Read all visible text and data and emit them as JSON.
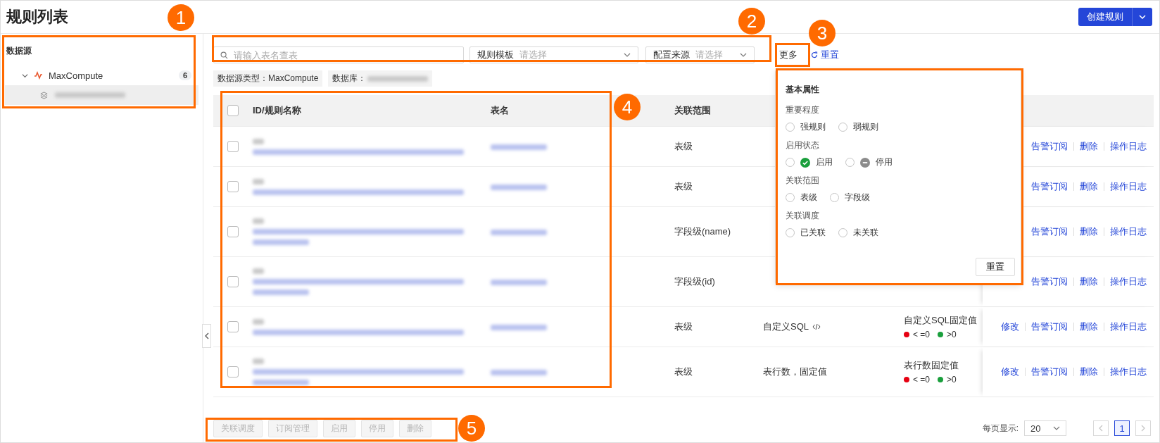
{
  "page_title": "规则列表",
  "create_button": {
    "label": "创建规则"
  },
  "sidebar": {
    "heading": "数据源",
    "tree": [
      {
        "label": "MaxCompute",
        "count": "6",
        "expanded": true,
        "children": [
          {
            "selected": true
          }
        ]
      }
    ]
  },
  "filters": {
    "search": {
      "placeholder": "请输入表名查表"
    },
    "selects": [
      {
        "label": "规则模板",
        "placeholder": "请选择"
      },
      {
        "label": "配置来源",
        "placeholder": "请选择"
      }
    ],
    "more_button": "更多",
    "reset_link": "重置"
  },
  "info_tags": [
    {
      "text": "数据源类型：MaxCompute",
      "redacted": false
    },
    {
      "text": "数据库：",
      "redacted": true
    }
  ],
  "table": {
    "all_checked": false,
    "columns": [
      {
        "label": "ID/规则名称"
      },
      {
        "label": "表名"
      },
      {
        "label": "关联范围"
      }
    ],
    "rows": [
      {
        "checked": false,
        "name_wraps": false,
        "scope": "表级",
        "actions": [
          "告警订阅",
          "删除",
          "操作日志"
        ]
      },
      {
        "checked": false,
        "name_wraps": false,
        "scope": "表级",
        "actions": [
          "告警订阅",
          "删除",
          "操作日志"
        ]
      },
      {
        "checked": false,
        "name_wraps": true,
        "scope": "字段级(name)",
        "actions": [
          "告警订阅",
          "删除",
          "操作日志"
        ]
      },
      {
        "checked": false,
        "name_wraps": true,
        "scope": "字段级(id)",
        "actions": [
          "告警订阅",
          "删除",
          "操作日志"
        ]
      },
      {
        "checked": false,
        "name_wraps": false,
        "scope": "表级",
        "column_5": {
          "text": "自定义SQL",
          "code_icon": true
        },
        "column_6": {
          "title": "自定义SQL固定值",
          "thresholds": [
            {
              "label": "< =0",
              "color": "#e60012"
            },
            {
              "label": ">0",
              "color": "#1a9f3c"
            }
          ]
        },
        "actions": [
          "修改",
          "告警订阅",
          "删除",
          "操作日志"
        ]
      },
      {
        "checked": false,
        "name_wraps": true,
        "scope": "表级",
        "column_5": {
          "text": "表行数，固定值",
          "code_icon": false
        },
        "column_6": {
          "title": "表行数固定值",
          "thresholds": [
            {
              "label": "< =0",
              "color": "#e60012"
            },
            {
              "label": ">0",
              "color": "#1a9f3c"
            }
          ]
        },
        "actions": [
          "修改",
          "告警订阅",
          "删除",
          "操作日志"
        ]
      }
    ]
  },
  "bulk_actions": [
    {
      "label": "关联调度",
      "disabled": true
    },
    {
      "label": "订阅管理",
      "disabled": true
    },
    {
      "label": "启用",
      "disabled": true
    },
    {
      "label": "停用",
      "disabled": true
    },
    {
      "label": "删除",
      "disabled": true
    }
  ],
  "pagination": {
    "page_size_label": "每页显示:",
    "page_size": "20",
    "prev_disabled": true,
    "next_disabled": true,
    "pages": [
      {
        "label": "1",
        "selected": true
      }
    ]
  },
  "popup": {
    "title": "基本属性",
    "groups": [
      {
        "label": "重要程度",
        "options": [
          {
            "label": "强规则",
            "selected": false,
            "kind": "plain"
          },
          {
            "label": "弱规则",
            "selected": false,
            "kind": "plain"
          }
        ]
      },
      {
        "label": "启用状态",
        "options": [
          {
            "label": "启用",
            "selected": false,
            "kind": "enabled"
          },
          {
            "label": "停用",
            "selected": false,
            "kind": "disabled"
          }
        ]
      },
      {
        "label": "关联范围",
        "options": [
          {
            "label": "表级",
            "selected": false,
            "kind": "plain"
          },
          {
            "label": "字段级",
            "selected": false,
            "kind": "plain"
          }
        ]
      },
      {
        "label": "关联调度",
        "options": [
          {
            "label": "已关联",
            "selected": false,
            "kind": "plain"
          },
          {
            "label": "未关联",
            "selected": false,
            "kind": "plain"
          }
        ]
      }
    ],
    "reset_button": "重置"
  },
  "callouts": [
    {
      "kind": "numbered",
      "number": "1"
    },
    {
      "kind": "numbered",
      "number": "2"
    },
    {
      "kind": "numbered",
      "number": "3"
    },
    {
      "kind": "numbered",
      "number": "4"
    },
    {
      "kind": "numbered",
      "number": "5"
    },
    {
      "kind": "frame"
    }
  ]
}
